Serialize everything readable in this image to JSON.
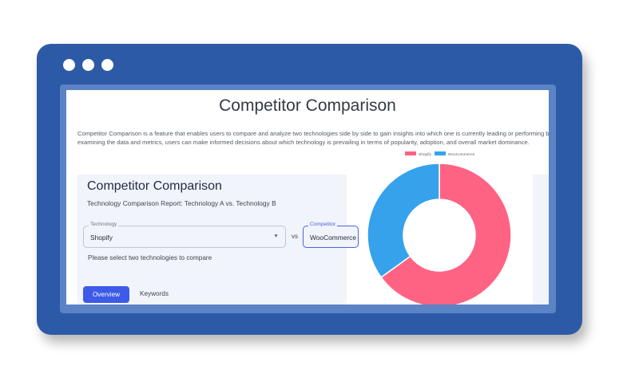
{
  "window": {
    "title_bar_dots": [
      "dot",
      "dot",
      "dot"
    ]
  },
  "page": {
    "title": "Competitor Comparison",
    "intro_line1": "Competitor Comparison is a feature that enables users to compare and analyze two technologies side by side to gain insights into which one is currently leading or performing better.",
    "intro_line2": "examining the data and metrics, users can make informed decisions about which technology is prevailing in terms of popularity, adoption, and overall market dominance."
  },
  "panel": {
    "title": "Competitor Comparison",
    "subtitle": "Technology Comparison Report: Technology A vs. Technology B",
    "technology": {
      "label": "Technology",
      "value": "Shopify"
    },
    "vs_label": "vs",
    "competitor": {
      "label": "Competitor",
      "value": "WooCommerce"
    },
    "hint": "Please select two technologies to compare",
    "tabs": [
      {
        "label": "Overview",
        "active": true
      },
      {
        "label": "Keywords",
        "active": false
      }
    ]
  },
  "colors": {
    "frame": "#2d5aa6",
    "accent_button": "#3d5ae8",
    "shopify": "#ff6384",
    "woocommerce": "#36a2eb"
  },
  "chart_data": {
    "type": "pie",
    "donut": true,
    "categories": [
      "Shopify",
      "WooCommerce"
    ],
    "values": [
      65,
      35
    ],
    "colors": [
      "#ff6384",
      "#36a2eb"
    ],
    "legend_position": "top"
  }
}
